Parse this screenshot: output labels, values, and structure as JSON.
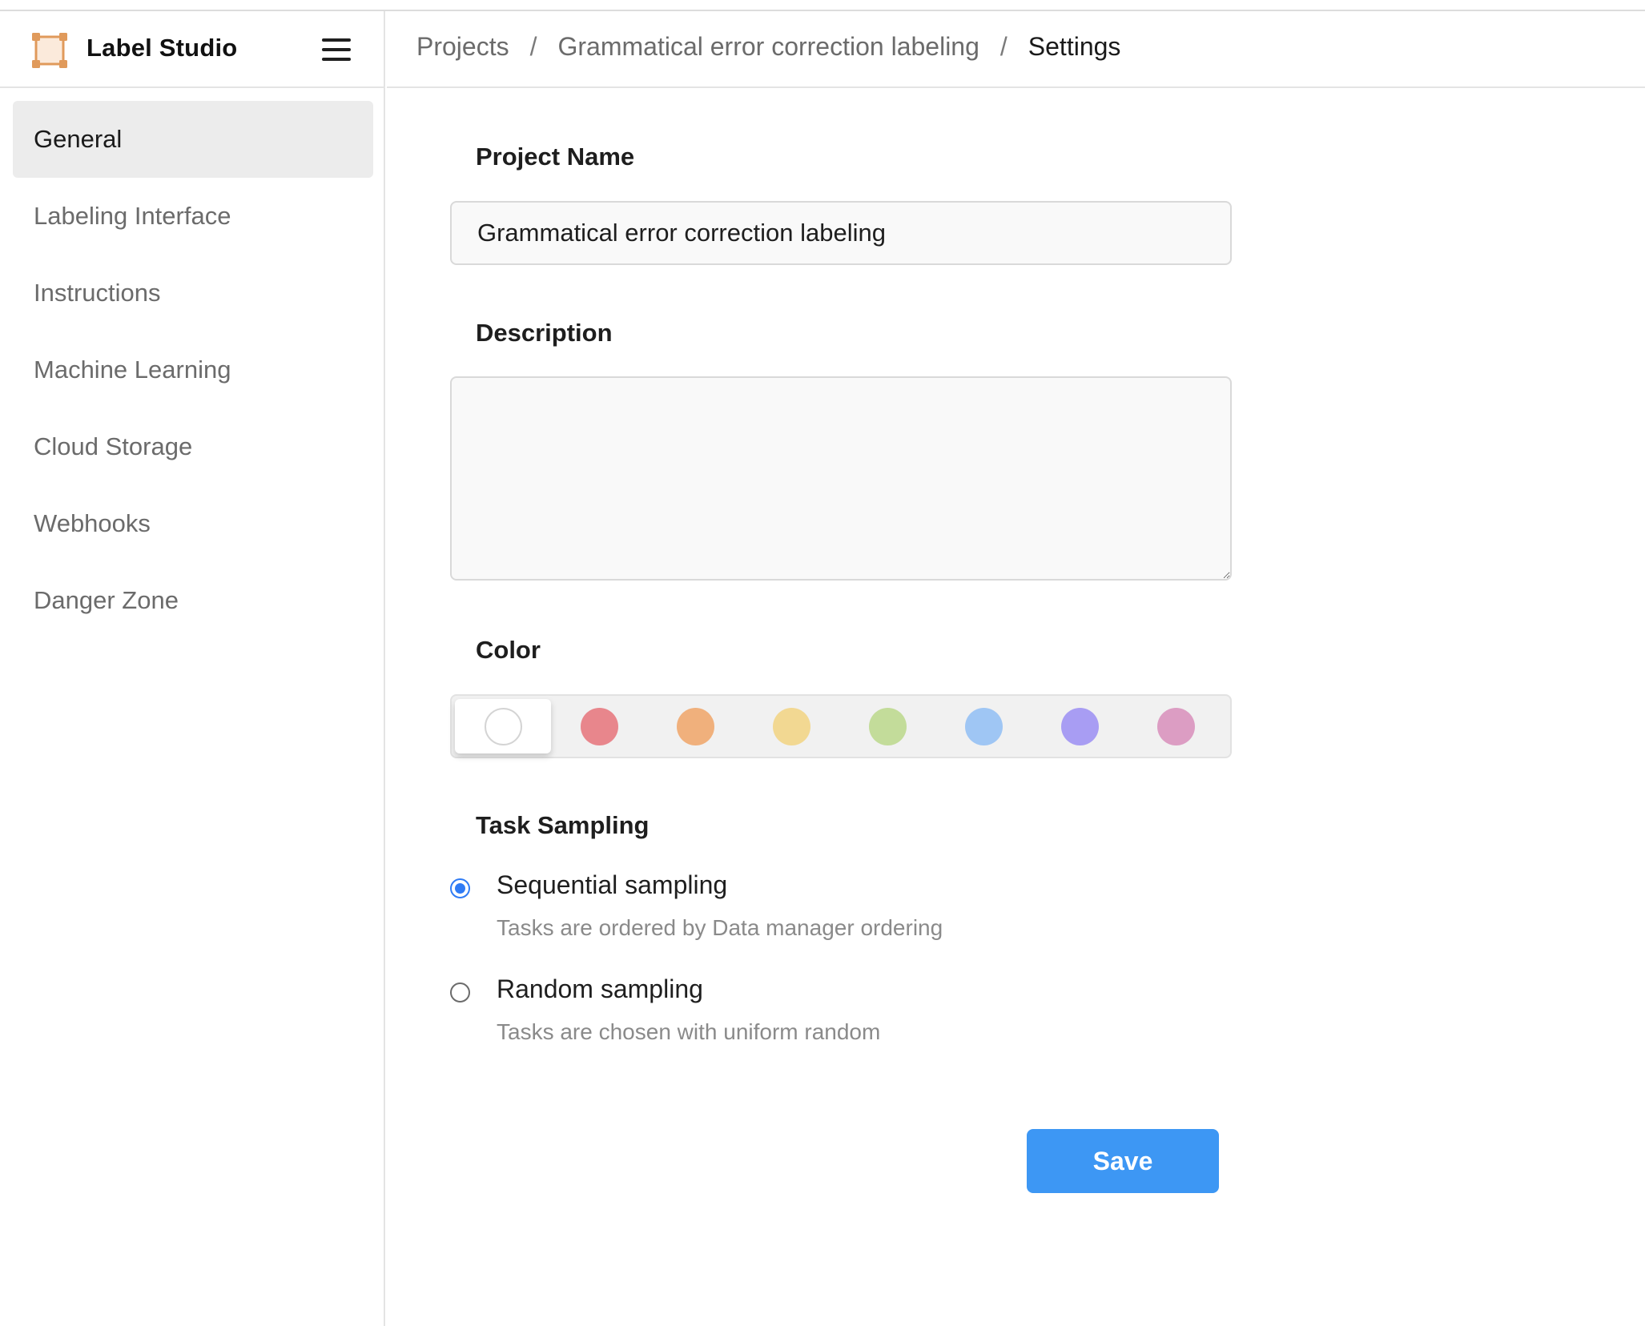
{
  "app": {
    "title": "Label Studio",
    "logo_icon": "label-studio-logo-icon",
    "menu_icon": "hamburger-menu-icon"
  },
  "breadcrumb": {
    "items": [
      "Projects",
      "Grammatical error correction labeling",
      "Settings"
    ],
    "separator": "/"
  },
  "sidebar": {
    "items": [
      {
        "label": "General",
        "active": true
      },
      {
        "label": "Labeling Interface",
        "active": false
      },
      {
        "label": "Instructions",
        "active": false
      },
      {
        "label": "Machine Learning",
        "active": false
      },
      {
        "label": "Cloud Storage",
        "active": false
      },
      {
        "label": "Webhooks",
        "active": false
      },
      {
        "label": "Danger Zone",
        "active": false
      }
    ]
  },
  "form": {
    "project_name": {
      "label": "Project Name",
      "value": "Grammatical error correction labeling"
    },
    "description": {
      "label": "Description",
      "value": ""
    },
    "color": {
      "label": "Color",
      "selected": 0,
      "swatches": [
        "#ffffff",
        "#e8868c",
        "#f0b07c",
        "#f2d892",
        "#c3dc9a",
        "#9fc6f4",
        "#a89df3",
        "#dc9dc3"
      ]
    },
    "task_sampling": {
      "label": "Task Sampling",
      "options": [
        {
          "title": "Sequential sampling",
          "description": "Tasks are ordered by Data manager ordering",
          "checked": true
        },
        {
          "title": "Random sampling",
          "description": "Tasks are chosen with uniform random",
          "checked": false
        }
      ]
    },
    "save_label": "Save"
  },
  "colors": {
    "accent": "#3d97f4",
    "radio_checked": "#2f7bf5",
    "logo": "#e09a5b"
  }
}
